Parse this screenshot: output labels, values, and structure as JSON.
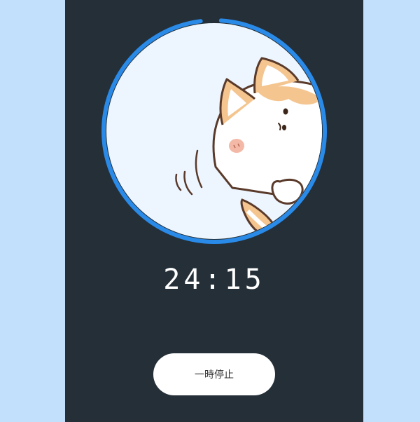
{
  "timer": {
    "time_text": "24:15",
    "progress_fraction": 0.97,
    "ring_color": "#2a8ae8",
    "illustration": "cat-peeking-illustration"
  },
  "controls": {
    "pause_label": "一時停止"
  },
  "colors": {
    "page_bg": "#c2dffc",
    "panel_bg": "#242f38",
    "circle_fill": "#edf6ff",
    "button_bg": "#ffffff"
  }
}
